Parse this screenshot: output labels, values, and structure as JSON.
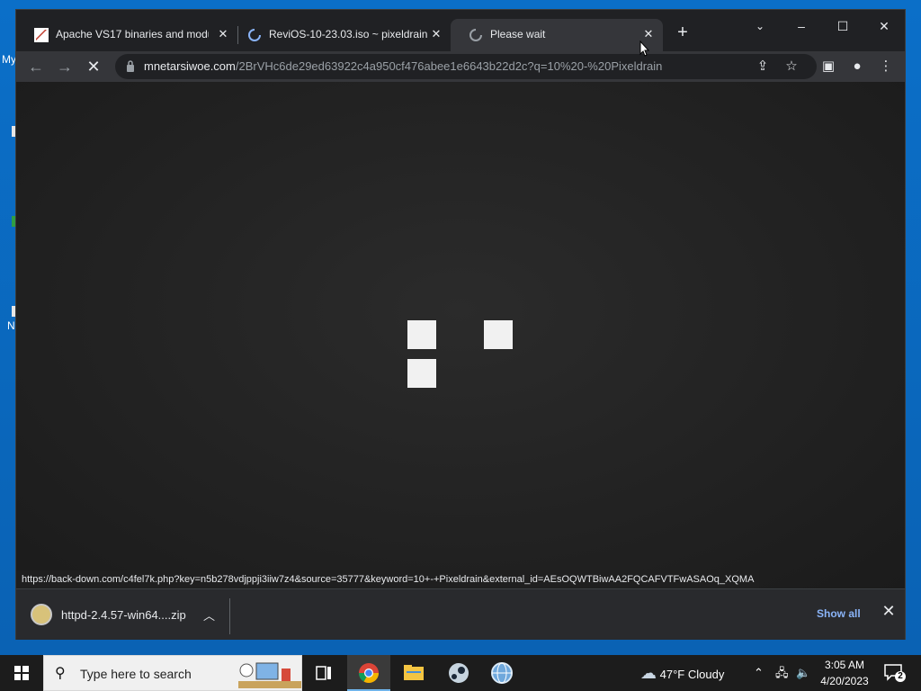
{
  "desktop": {
    "edge_texts": [
      "My",
      "N"
    ]
  },
  "browser": {
    "tabs": [
      {
        "title": "Apache VS17 binaries and modu",
        "active": false,
        "favicon": "apache-feather-icon"
      },
      {
        "title": "ReviOS-10-23.03.iso ~ pixeldrain",
        "active": false,
        "favicon": "loading-spinner-icon"
      },
      {
        "title": "Please wait",
        "active": true,
        "favicon": "loading-spinner-icon"
      }
    ],
    "url_host": "mnetarsiwoe.com",
    "url_path": "/2BrVHc6de29ed63922c4a950cf476abee1e6643b22d2c?q=10%20-%20Pixeldrain",
    "status_url": "https://back-down.com/c4fel7k.php?key=n5b278vdjppji3iiw7z4&source=35777&keyword=10+-+Pixeldrain&external_id=AEsOQWTBiwAA2FQCAFVTFwASAOq_XQMA"
  },
  "download_bar": {
    "file_name": "httpd-2.4.57-win64....zip",
    "show_all_label": "Show all"
  },
  "taskbar": {
    "search_placeholder": "Type here to search",
    "weather_temp": "47°F",
    "weather_desc": "Cloudy",
    "time": "3:05 AM",
    "date": "4/20/2023",
    "notification_count": "2"
  },
  "colors": {
    "accent": "#8ab4f8",
    "chrome_dark": "#202124",
    "active_tab": "#35363a",
    "desktop_blue": "#0a6ec4"
  }
}
